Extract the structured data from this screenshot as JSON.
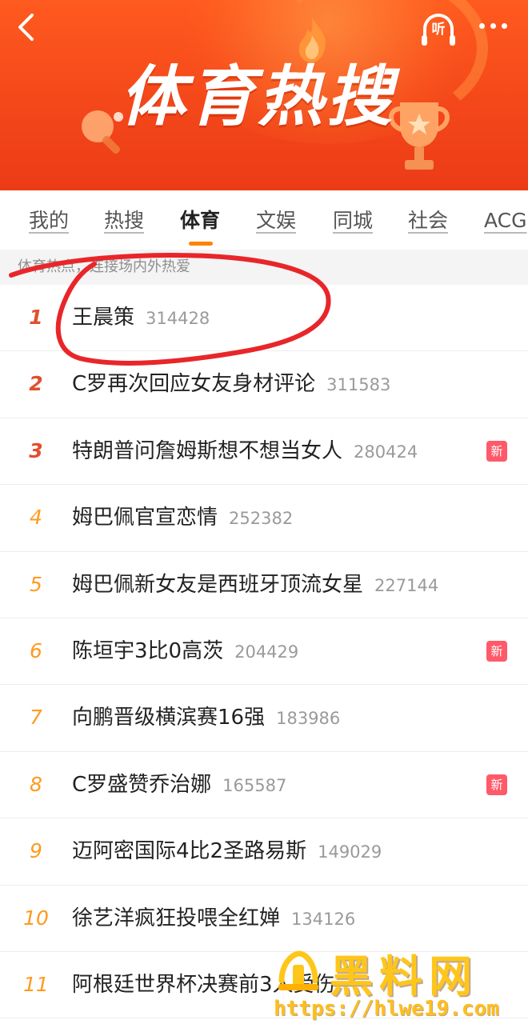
{
  "header": {
    "title": "体育热搜",
    "listen_label": "听"
  },
  "tabs": [
    {
      "label": "我的"
    },
    {
      "label": "热搜"
    },
    {
      "label": "体育"
    },
    {
      "label": "文娱"
    },
    {
      "label": "同城"
    },
    {
      "label": "社会"
    },
    {
      "label": "ACG"
    }
  ],
  "active_tab": "体育",
  "subtitle": "体育热点，连接场内外热爱",
  "list": [
    {
      "rank": "1",
      "topic": "王晨策",
      "count": "314428",
      "badge": ""
    },
    {
      "rank": "2",
      "topic": "C罗再次回应女友身材评论",
      "count": "311583",
      "badge": ""
    },
    {
      "rank": "3",
      "topic": "特朗普问詹姆斯想不想当女人",
      "count": "280424",
      "badge": "新"
    },
    {
      "rank": "4",
      "topic": "姆巴佩官宣恋情",
      "count": "252382",
      "badge": ""
    },
    {
      "rank": "5",
      "topic": "姆巴佩新女友是西班牙顶流女星",
      "count": "227144",
      "badge": ""
    },
    {
      "rank": "6",
      "topic": "陈垣宇3比0高茨",
      "count": "204429",
      "badge": "新"
    },
    {
      "rank": "7",
      "topic": "向鹏晋级横滨赛16强",
      "count": "183986",
      "badge": ""
    },
    {
      "rank": "8",
      "topic": "C罗盛赞乔治娜",
      "count": "165587",
      "badge": "新"
    },
    {
      "rank": "9",
      "topic": "迈阿密国际4比2圣路易斯",
      "count": "149029",
      "badge": ""
    },
    {
      "rank": "10",
      "topic": "徐艺洋疯狂投喂全红婵",
      "count": "134126",
      "badge": ""
    },
    {
      "rank": "11",
      "topic": "阿根廷世界杯决赛前3人受伤",
      "count": "",
      "badge": ""
    }
  ],
  "watermark": {
    "title": "黑料网",
    "url": "https://hlwe19.com"
  },
  "colors": {
    "banner": "#f4471a",
    "accent": "#ff8200",
    "rank_top": "#e0502e",
    "rank_other": "#ff9a1f",
    "new_badge": "#ff5a6a",
    "annotation": "#e8262a"
  }
}
